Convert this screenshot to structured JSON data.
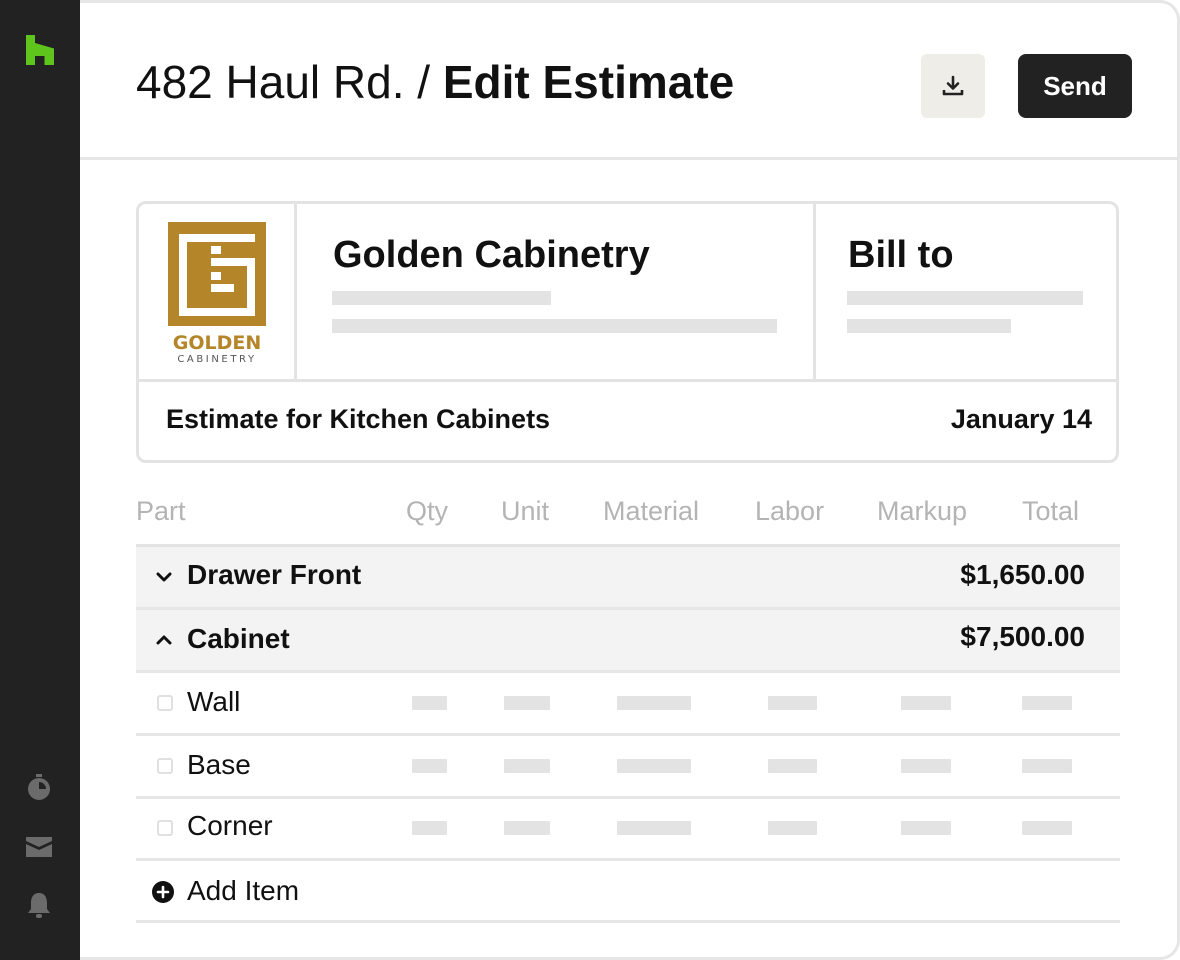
{
  "app": {
    "brand_color": "#5fc51d",
    "sidebar_color": "#222222"
  },
  "header": {
    "address": "482 Haul Rd.",
    "separator": "/",
    "page_title": "Edit Estimate",
    "download_icon": "download-icon",
    "send_label": "Send"
  },
  "estimate_card": {
    "logo": {
      "brand_text": "GOLDEN",
      "sub_text": "CABINETRY",
      "color": "#b5852a"
    },
    "company_name": "Golden Cabinetry",
    "bill_to_label": "Bill to",
    "estimate_label": "Estimate for Kitchen Cabinets",
    "date": "January 14"
  },
  "table": {
    "columns": [
      "Part",
      "Qty",
      "Unit",
      "Material",
      "Labor",
      "Markup",
      "Total"
    ],
    "groups": [
      {
        "label": "Drawer Front",
        "total": "$1,650.00",
        "expanded": false
      },
      {
        "label": "Cabinet",
        "total": "$7,500.00",
        "expanded": true
      }
    ],
    "items": [
      "Wall",
      "Base",
      "Corner"
    ],
    "add_item_label": "Add Item"
  },
  "sidebar": {
    "icons": [
      "houzz-logo-icon",
      "stopwatch-icon",
      "inbox-icon",
      "bell-icon"
    ]
  }
}
